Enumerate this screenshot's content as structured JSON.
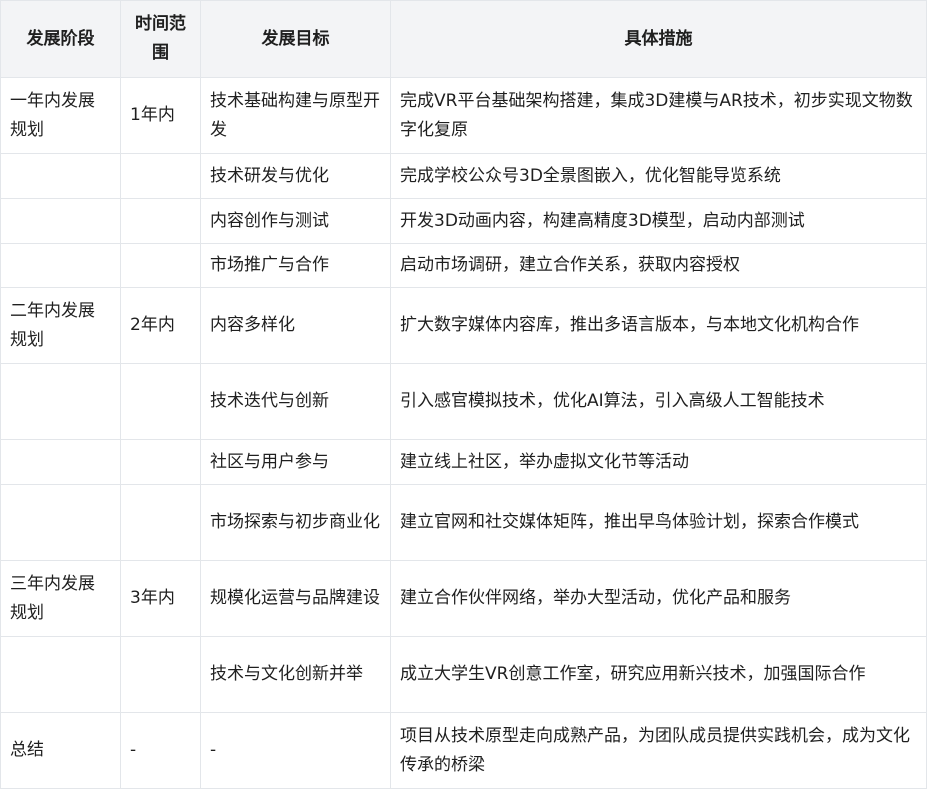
{
  "headers": [
    "发展阶段",
    "时间范围",
    "发展目标",
    "具体措施"
  ],
  "rows": [
    {
      "stage": "一年内发展规划",
      "time": "1年内",
      "goal": "技术基础构建与原型开发",
      "measure": "完成VR平台基础架构搭建，集成3D建模与AR技术，初步实现文物数字化复原"
    },
    {
      "stage": "",
      "time": "",
      "goal": "技术研发与优化",
      "measure": "完成学校公众号3D全景图嵌入，优化智能导览系统"
    },
    {
      "stage": "",
      "time": "",
      "goal": "内容创作与测试",
      "measure": "开发3D动画内容，构建高精度3D模型，启动内部测试"
    },
    {
      "stage": "",
      "time": "",
      "goal": "市场推广与合作",
      "measure": "启动市场调研，建立合作关系，获取内容授权"
    },
    {
      "stage": "二年内发展规划",
      "time": "2年内",
      "goal": "内容多样化",
      "measure": "扩大数字媒体内容库，推出多语言版本，与本地文化机构合作"
    },
    {
      "stage": "",
      "time": "",
      "goal": "技术迭代与创新",
      "measure": "引入感官模拟技术，优化AI算法，引入高级人工智能技术"
    },
    {
      "stage": "",
      "time": "",
      "goal": "社区与用户参与",
      "measure": "建立线上社区，举办虚拟文化节等活动"
    },
    {
      "stage": "",
      "time": "",
      "goal": "市场探索与初步商业化",
      "measure": "建立官网和社交媒体矩阵，推出早鸟体验计划，探索合作模式"
    },
    {
      "stage": "三年内发展规划",
      "time": "3年内",
      "goal": "规模化运营与品牌建设",
      "measure": "建立合作伙伴网络，举办大型活动，优化产品和服务"
    },
    {
      "stage": "",
      "time": "",
      "goal": "技术与文化创新并举",
      "measure": "成立大学生VR创意工作室，研究应用新兴技术，加强国际合作"
    },
    {
      "stage": "总结",
      "time": "-",
      "goal": "-",
      "measure": "项目从技术原型走向成熟产品，为团队成员提供实践机会，成为文化传承的桥梁"
    }
  ]
}
